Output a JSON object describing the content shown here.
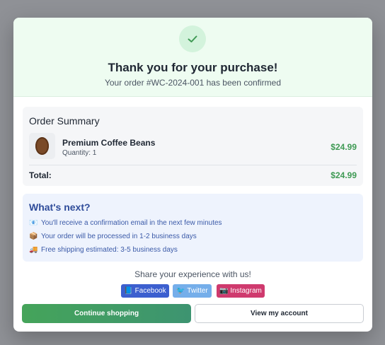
{
  "header": {
    "title": "Thank you for your purchase!",
    "subtitle": "Your order #WC-2024-001 has been confirmed",
    "icon": "check-icon"
  },
  "order_summary": {
    "title": "Order Summary",
    "items": [
      {
        "name": "Premium Coffee Beans",
        "quantity": "Quantity: 1",
        "price": "$24.99",
        "icon": "coffee-bean-icon"
      }
    ],
    "total_label": "Total:",
    "total_value": "$24.99"
  },
  "whats_next": {
    "title": "What's next?",
    "items": [
      {
        "emoji": "📧",
        "text": "You'll receive a confirmation email in the next few minutes"
      },
      {
        "emoji": "📦",
        "text": "Your order will be processed in 1-2 business days"
      },
      {
        "emoji": "🚚",
        "text": "Free shipping estimated: 3-5 business days"
      }
    ]
  },
  "share": {
    "text": "Share your experience with us!",
    "facebook": "📘 Facebook",
    "twitter": "🐦 Twitter",
    "instagram": "📷 Instagram"
  },
  "actions": {
    "continue": "Continue shopping",
    "account": "View my account"
  },
  "colors": {
    "success": "#3f9a54",
    "header_bg": "#eefcf1",
    "info_bg": "#eef3fd",
    "facebook": "#3c5fcf",
    "twitter": "#75aeea",
    "instagram": "#cf3a6e"
  }
}
